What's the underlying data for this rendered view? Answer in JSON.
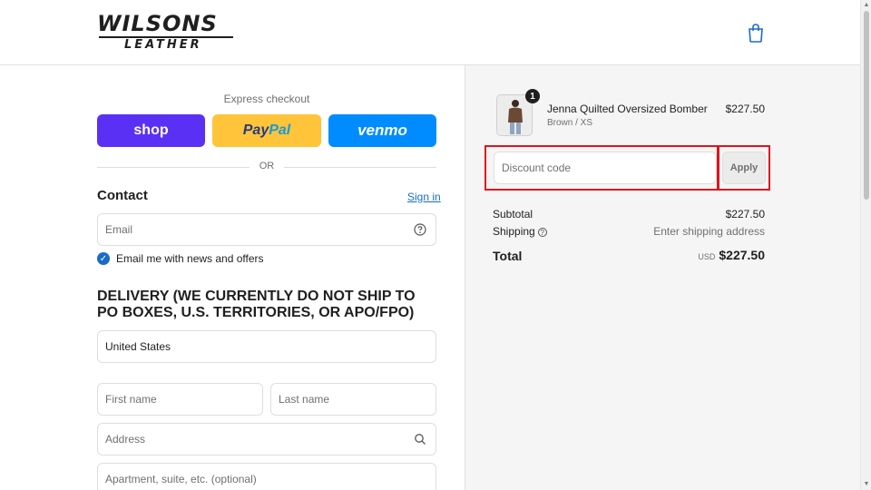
{
  "header": {
    "logo_top": "WILSONS",
    "logo_bottom": "LEATHER",
    "cart_icon": "shopping-bag-icon"
  },
  "checkout": {
    "express_label": "Express checkout",
    "shop_label": "shop",
    "paypal_label_1": "Pay",
    "paypal_label_2": "Pal",
    "venmo_label": "venmo",
    "or_label": "OR",
    "contact_title": "Contact",
    "signin_label": "Sign in",
    "email_placeholder": "Email",
    "newsletter_label": "Email me with news and offers",
    "newsletter_checked": true,
    "delivery_title": "DELIVERY (WE CURRENTLY DO NOT SHIP TO PO BOXES, U.S. TERRITORIES, OR APO/FPO)",
    "country_value": "United States",
    "first_name_placeholder": "First name",
    "last_name_placeholder": "Last name",
    "address_placeholder": "Address",
    "apartment_placeholder": "Apartment, suite, etc. (optional)"
  },
  "summary": {
    "product": {
      "name": "Jenna Quilted Oversized Bomber",
      "variant": "Brown / XS",
      "price": "$227.50",
      "quantity": "1"
    },
    "discount_placeholder": "Discount code",
    "apply_label": "Apply",
    "subtotal_label": "Subtotal",
    "subtotal_value": "$227.50",
    "shipping_label": "Shipping",
    "shipping_value": "Enter shipping address",
    "total_label": "Total",
    "currency": "USD",
    "total_value": "$227.50"
  },
  "colors": {
    "shop": "#5a31f4",
    "paypal": "#ffc439",
    "venmo": "#008cff",
    "link": "#1a6bc9",
    "highlight": "#e0131b"
  }
}
